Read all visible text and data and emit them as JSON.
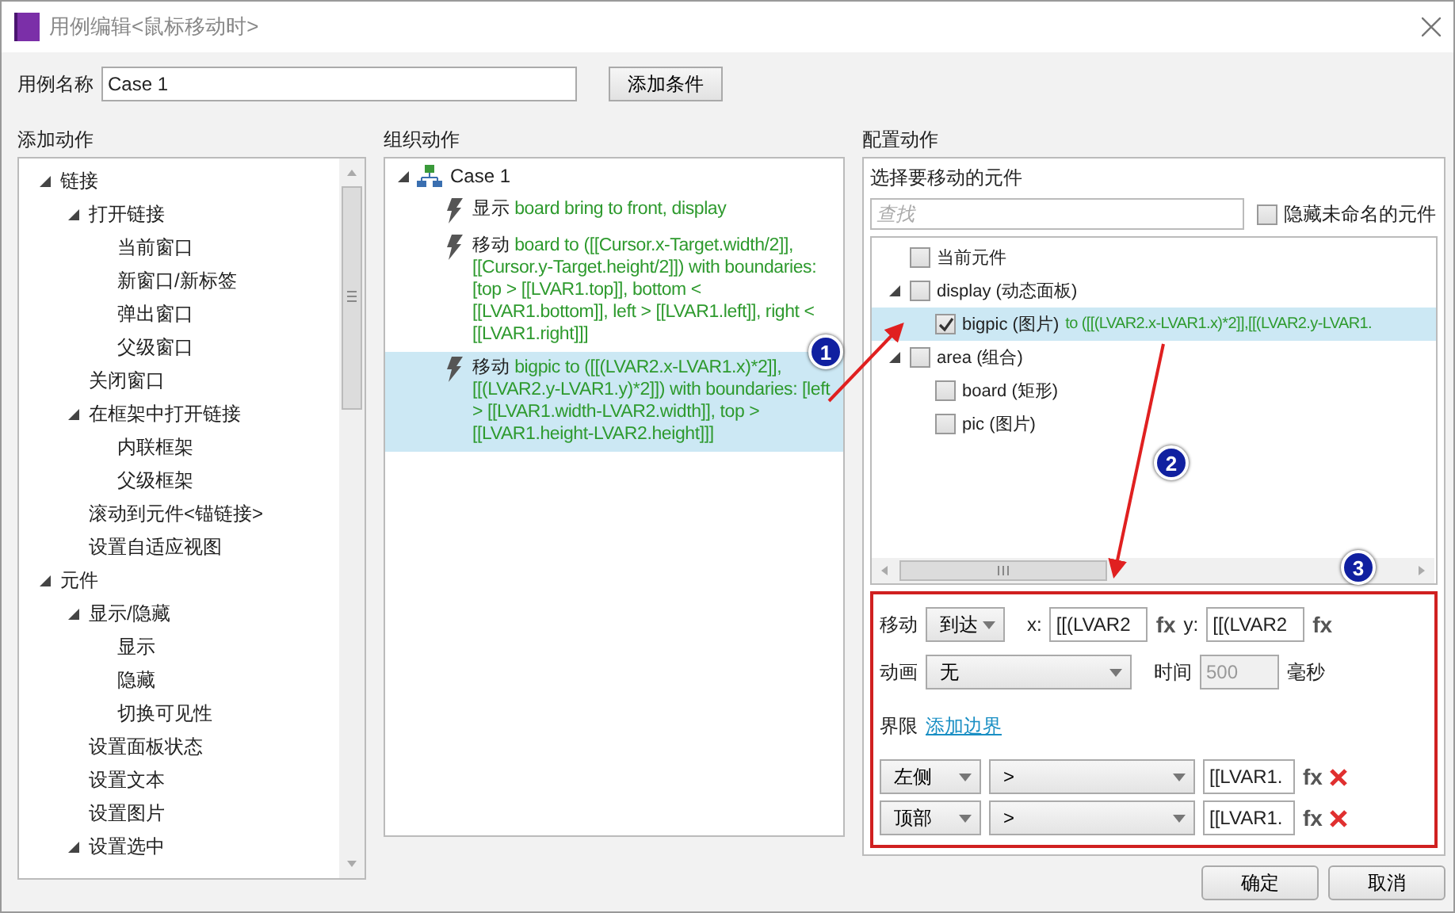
{
  "window": {
    "title": "用例编辑<鼠标移动时>"
  },
  "case_name": {
    "label": "用例名称",
    "value": "Case 1"
  },
  "add_condition_button": "添加条件",
  "add_actions": {
    "heading": "添加动作",
    "tree": [
      {
        "label": "链接",
        "expanded": true,
        "children": [
          {
            "label": "打开链接",
            "expanded": true,
            "children": [
              {
                "label": "当前窗口"
              },
              {
                "label": "新窗口/新标签"
              },
              {
                "label": "弹出窗口"
              },
              {
                "label": "父级窗口"
              }
            ]
          },
          {
            "label": "关闭窗口"
          },
          {
            "label": "在框架中打开链接",
            "expanded": true,
            "children": [
              {
                "label": "内联框架"
              },
              {
                "label": "父级框架"
              }
            ]
          },
          {
            "label": "滚动到元件<锚链接>"
          },
          {
            "label": "设置自适应视图"
          }
        ]
      },
      {
        "label": "元件",
        "expanded": true,
        "children": [
          {
            "label": "显示/隐藏",
            "expanded": true,
            "children": [
              {
                "label": "显示"
              },
              {
                "label": "隐藏"
              },
              {
                "label": "切换可见性"
              }
            ]
          },
          {
            "label": "设置面板状态"
          },
          {
            "label": "设置文本"
          },
          {
            "label": "设置图片"
          },
          {
            "label": "设置选中",
            "expanded": true
          }
        ]
      }
    ]
  },
  "organize_actions": {
    "heading": "组织动作",
    "case": {
      "label": "Case 1",
      "expanded": true,
      "actions": [
        {
          "verb": "显示",
          "detail": "board bring to front, display",
          "selected": false
        },
        {
          "verb": "移动",
          "detail": "board to ([[Cursor.x-Target.width/2]], [[Cursor.y-Target.height/2]]) with boundaries: [top > [[LVAR1.top]], bottom < [[LVAR1.bottom]], left > [[LVAR1.left]], right < [[LVAR1.right]]]",
          "selected": false
        },
        {
          "verb": "移动",
          "detail": "bigpic to ([[(LVAR2.x-LVAR1.x)*2]], [[(LVAR2.y-LVAR1.y)*2]]) with boundaries: [left > [[LVAR1.width-LVAR2.width]], top > [[LVAR1.height-LVAR2.height]]]",
          "selected": true
        }
      ]
    }
  },
  "configure_actions": {
    "heading": "配置动作",
    "picker": {
      "label": "选择要移动的元件",
      "search": {
        "placeholder": "查找"
      },
      "hide_unnamed": {
        "label": "隐藏未命名的元件",
        "checked": false
      },
      "widgets": [
        {
          "label": "当前元件",
          "checked": false,
          "selected": false
        },
        {
          "label": "display (动态面板)",
          "checked": false,
          "selected": false,
          "expanded": true,
          "children": [
            {
              "label": "bigpic (图片)",
              "detail": "to ([[(LVAR2.x-LVAR1.x)*2]],[[(LVAR2.y-LVAR1.",
              "checked": true,
              "selected": true
            }
          ]
        },
        {
          "label": "area (组合)",
          "checked": false,
          "selected": false,
          "expanded": true,
          "children": [
            {
              "label": "board (矩形)",
              "checked": false,
              "selected": false
            },
            {
              "label": "pic (图片)",
              "checked": false,
              "selected": false
            }
          ]
        }
      ]
    },
    "move": {
      "label": "移动",
      "mode": "到达",
      "x_label": "x:",
      "x_value": "[[(LVAR2",
      "x_fx": "fx",
      "y_label": "y:",
      "y_value": "[[(LVAR2",
      "y_fx": "fx"
    },
    "animation": {
      "label": "动画",
      "value": "无",
      "time_label": "时间",
      "time_value": "500",
      "time_disabled": true,
      "unit": "毫秒"
    },
    "bounds": {
      "label": "界限",
      "add_link": "添加边界",
      "rows": [
        {
          "side": "左侧",
          "operator": ">",
          "value": "[[LVAR1.",
          "fx": "fx"
        },
        {
          "side": "顶部",
          "operator": ">",
          "value": "[[LVAR1.",
          "fx": "fx"
        }
      ]
    }
  },
  "annotations": [
    "1",
    "2",
    "3"
  ],
  "buttons": {
    "ok": "确定",
    "cancel": "取消"
  }
}
